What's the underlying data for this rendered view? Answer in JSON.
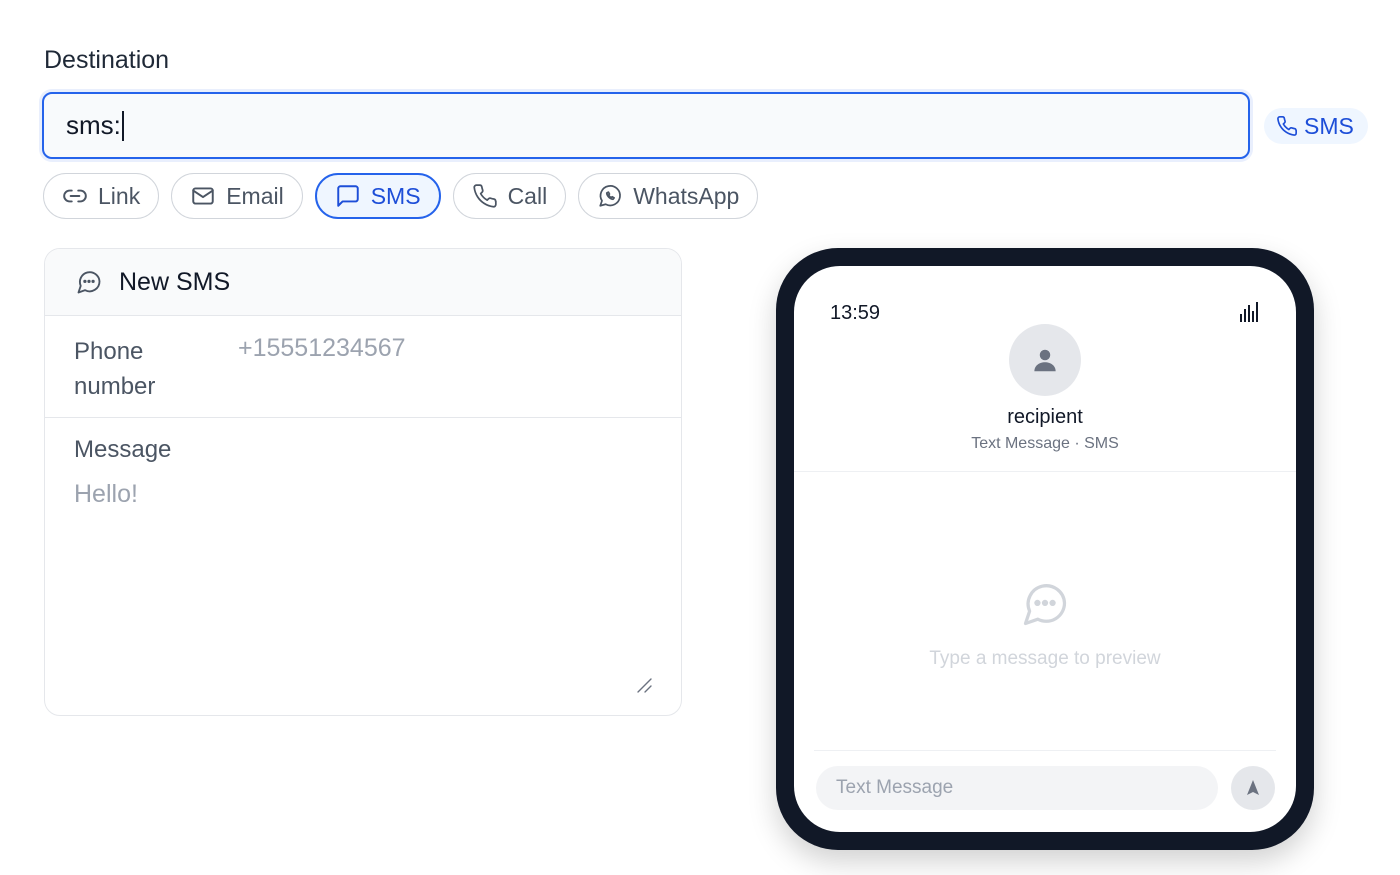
{
  "destination": {
    "label": "Destination",
    "value": "sms:",
    "detected_type": "SMS"
  },
  "type_chips": [
    {
      "label": "Link",
      "icon": "link-icon",
      "active": false
    },
    {
      "label": "Email",
      "icon": "mail-icon",
      "active": false
    },
    {
      "label": "SMS",
      "icon": "message-square-icon",
      "active": true
    },
    {
      "label": "Call",
      "icon": "phone-icon",
      "active": false
    },
    {
      "label": "WhatsApp",
      "icon": "whatsapp-icon",
      "active": false
    }
  ],
  "sms_form": {
    "title": "New SMS",
    "phone_label": "Phone number",
    "phone_placeholder": "+15551234567",
    "message_label": "Message",
    "message_placeholder": "Hello!"
  },
  "phone_preview": {
    "time": "13:59",
    "recipient": "recipient",
    "subtitle": "Text Message · SMS",
    "empty_text": "Type a message to preview",
    "compose_placeholder": "Text Message"
  },
  "colors": {
    "accent": "#2563eb",
    "accent_bg": "#eff6ff",
    "phone_frame": "#111827"
  }
}
